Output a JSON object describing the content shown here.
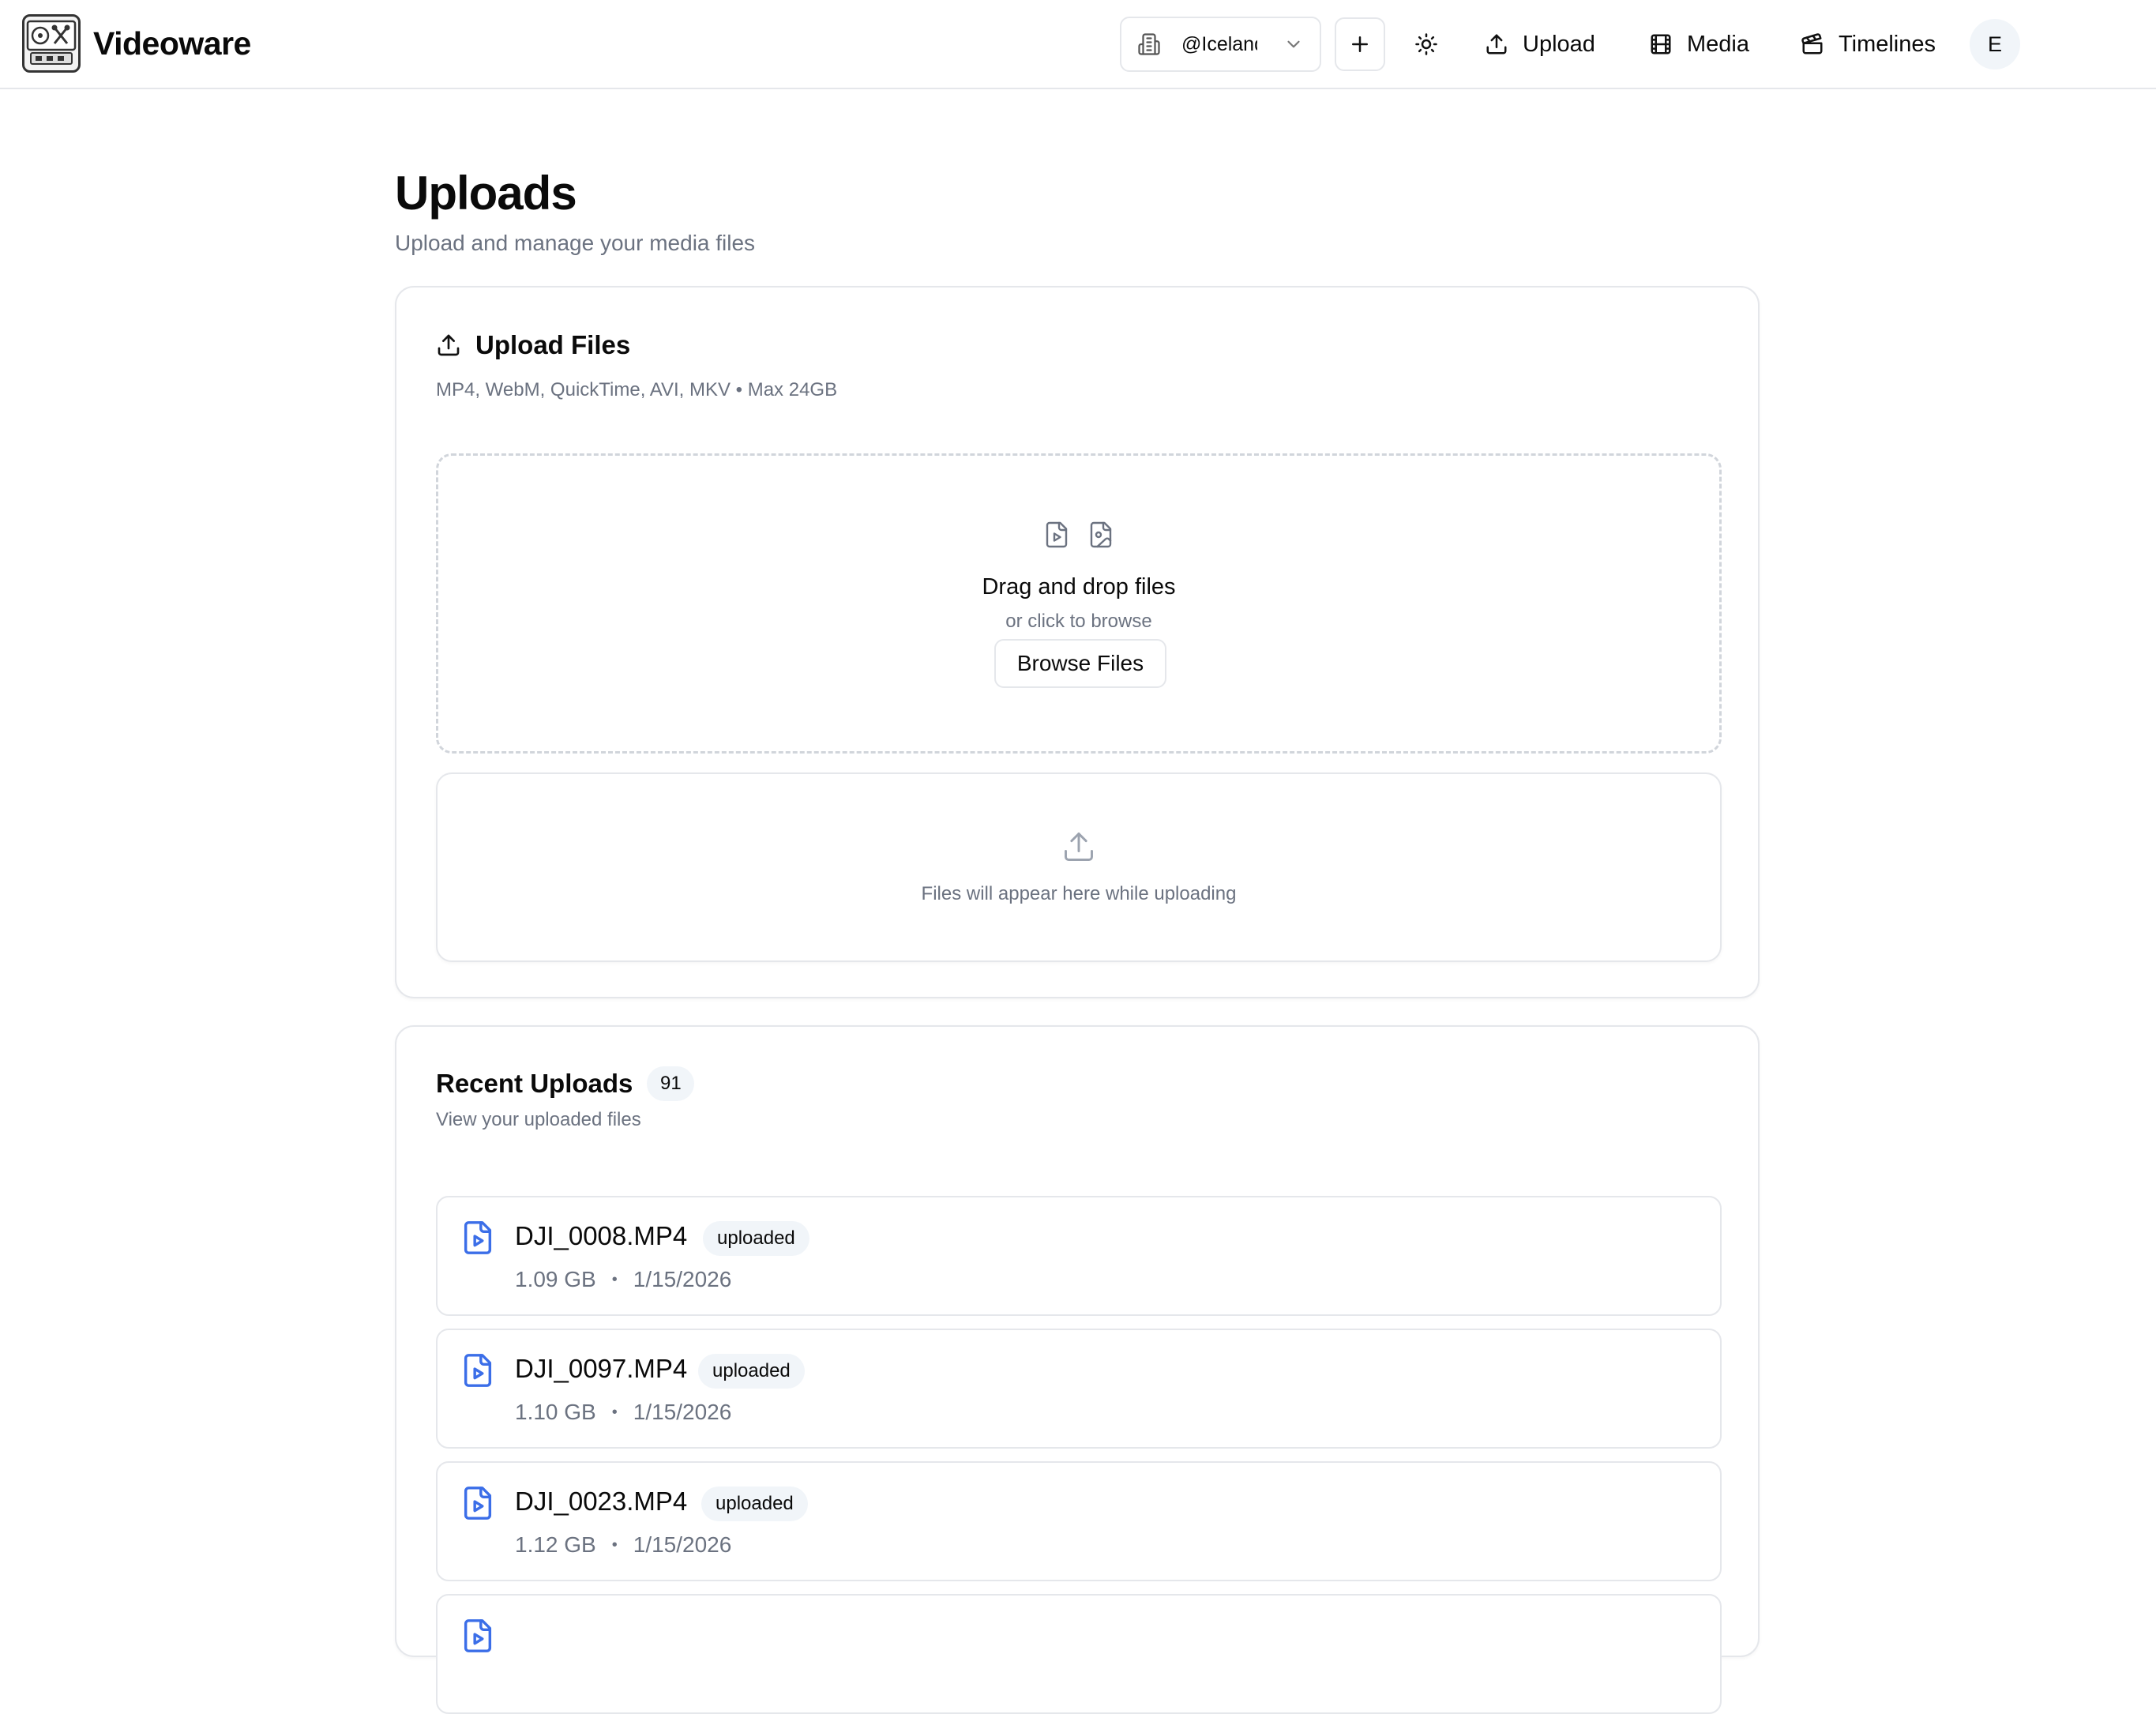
{
  "header": {
    "brand": "Videoware",
    "workspace": "@Iceland",
    "nav": [
      {
        "label": "Upload",
        "icon": "upload-icon"
      },
      {
        "label": "Media",
        "icon": "film-icon"
      },
      {
        "label": "Timelines",
        "icon": "clapperboard-icon"
      }
    ],
    "avatar_initial": "E"
  },
  "page": {
    "title": "Uploads",
    "subtitle": "Upload and manage your media files"
  },
  "upload_files": {
    "title": "Upload Files",
    "formats": "MP4, WebM, QuickTime, AVI, MKV • Max 24GB",
    "dropzone_title": "Drag and drop files",
    "dropzone_sub": "or click to browse",
    "browse_label": "Browse Files",
    "empty_progress": "Files will appear here while uploading"
  },
  "recent": {
    "title": "Recent Uploads",
    "count": "91",
    "subtitle": "View your uploaded files",
    "files": [
      {
        "name": "DJI_0008.MP4",
        "status": "uploaded",
        "size": "1.09 GB",
        "date": "1/15/2026"
      },
      {
        "name": "DJI_0097.MP4",
        "status": "uploaded",
        "size": "1.10 GB",
        "date": "1/15/2026"
      },
      {
        "name": "DJI_0023.MP4",
        "status": "uploaded",
        "size": "1.12 GB",
        "date": "1/15/2026"
      },
      {
        "name": "",
        "status": "",
        "size": "",
        "date": ""
      }
    ]
  },
  "colors": {
    "accent": "#3b6ee8",
    "muted": "#6b7280",
    "border": "#e5e7eb",
    "badge_bg": "#f1f5f9"
  }
}
